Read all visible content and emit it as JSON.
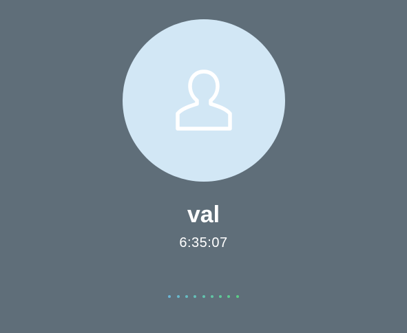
{
  "call": {
    "contact_name": "val",
    "timer": "6:35:07",
    "avatar_icon": "person-icon"
  },
  "colors": {
    "background": "#5f6e79",
    "avatar_fill": "#d2e7f5",
    "text": "#ffffff"
  },
  "signal_dots": [
    {
      "color": "#6bb6d6"
    },
    {
      "color": "#69b9cc"
    },
    {
      "color": "#67bcc2"
    },
    {
      "color": "#65bfb8"
    },
    {
      "color": "#63c2ae"
    },
    {
      "color": "#61c5a4"
    },
    {
      "color": "#5fc89a"
    },
    {
      "color": "#5dcb90"
    },
    {
      "color": "#5bce86"
    }
  ]
}
